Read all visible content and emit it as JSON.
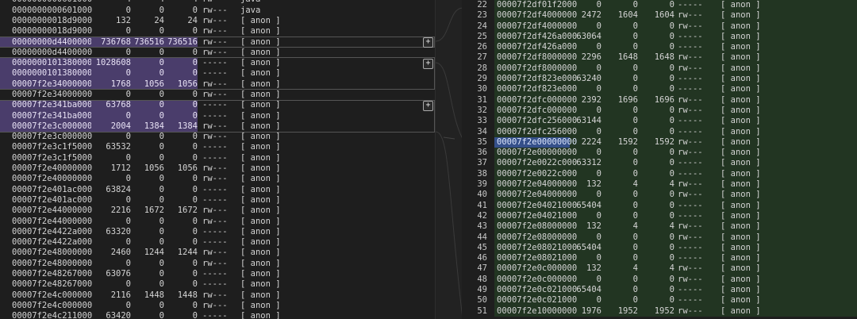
{
  "left": {
    "rows": [
      {
        "addr": "0000000000601000",
        "n1": "4",
        "n2": "4",
        "n3": "4",
        "perm": "rw---",
        "map": "java"
      },
      {
        "addr": "0000000000601000",
        "n1": "0",
        "n2": "0",
        "n3": "0",
        "perm": "rw---",
        "map": "java"
      },
      {
        "addr": "00000000018d9000",
        "n1": "132",
        "n2": "24",
        "n3": "24",
        "perm": "rw---",
        "map": "[ anon ]"
      },
      {
        "addr": "00000000018d9000",
        "n1": "0",
        "n2": "0",
        "n3": "0",
        "perm": "rw---",
        "map": "[ anon ]"
      },
      {
        "addr": "00000000d4400000",
        "n1": "736768",
        "n2": "736516",
        "n3": "736516",
        "perm": "rw---",
        "map": "[ anon ]",
        "hl": true
      },
      {
        "addr": "00000000d4400000",
        "n1": "0",
        "n2": "0",
        "n3": "0",
        "perm": "rw---",
        "map": "[ anon ]"
      },
      {
        "addr": "0000000101380000",
        "n1": "1028608",
        "n2": "0",
        "n3": "0",
        "perm": "-----",
        "map": "[ anon ]",
        "hl": true
      },
      {
        "addr": "0000000101380000",
        "n1": "0",
        "n2": "0",
        "n3": "0",
        "perm": "-----",
        "map": "[ anon ]",
        "hl": true
      },
      {
        "addr": "00007f2e34000000",
        "n1": "1768",
        "n2": "1056",
        "n3": "1056",
        "perm": "rw---",
        "map": "[ anon ]",
        "hl": true
      },
      {
        "addr": "00007f2e34000000",
        "n1": "0",
        "n2": "0",
        "n3": "0",
        "perm": "rw---",
        "map": "[ anon ]"
      },
      {
        "addr": "00007f2e341ba000",
        "n1": "63768",
        "n2": "0",
        "n3": "0",
        "perm": "-----",
        "map": "[ anon ]",
        "hl": true
      },
      {
        "addr": "00007f2e341ba000",
        "n1": "0",
        "n2": "0",
        "n3": "0",
        "perm": "-----",
        "map": "[ anon ]",
        "hl": true
      },
      {
        "addr": "00007f2e3c000000",
        "n1": "2004",
        "n2": "1384",
        "n3": "1384",
        "perm": "rw---",
        "map": "[ anon ]",
        "hl": true
      },
      {
        "addr": "00007f2e3c000000",
        "n1": "0",
        "n2": "0",
        "n3": "0",
        "perm": "rw---",
        "map": "[ anon ]"
      },
      {
        "addr": "00007f2e3c1f5000",
        "n1": "63532",
        "n2": "0",
        "n3": "0",
        "perm": "-----",
        "map": "[ anon ]"
      },
      {
        "addr": "00007f2e3c1f5000",
        "n1": "0",
        "n2": "0",
        "n3": "0",
        "perm": "-----",
        "map": "[ anon ]"
      },
      {
        "addr": "00007f2e40000000",
        "n1": "1712",
        "n2": "1056",
        "n3": "1056",
        "perm": "rw---",
        "map": "[ anon ]"
      },
      {
        "addr": "00007f2e40000000",
        "n1": "0",
        "n2": "0",
        "n3": "0",
        "perm": "rw---",
        "map": "[ anon ]"
      },
      {
        "addr": "00007f2e401ac000",
        "n1": "63824",
        "n2": "0",
        "n3": "0",
        "perm": "-----",
        "map": "[ anon ]"
      },
      {
        "addr": "00007f2e401ac000",
        "n1": "0",
        "n2": "0",
        "n3": "0",
        "perm": "-----",
        "map": "[ anon ]"
      },
      {
        "addr": "00007f2e44000000",
        "n1": "2216",
        "n2": "1672",
        "n3": "1672",
        "perm": "rw---",
        "map": "[ anon ]"
      },
      {
        "addr": "00007f2e44000000",
        "n1": "0",
        "n2": "0",
        "n3": "0",
        "perm": "rw---",
        "map": "[ anon ]"
      },
      {
        "addr": "00007f2e4422a000",
        "n1": "63320",
        "n2": "0",
        "n3": "0",
        "perm": "-----",
        "map": "[ anon ]"
      },
      {
        "addr": "00007f2e4422a000",
        "n1": "0",
        "n2": "0",
        "n3": "0",
        "perm": "-----",
        "map": "[ anon ]"
      },
      {
        "addr": "00007f2e48000000",
        "n1": "2460",
        "n2": "1244",
        "n3": "1244",
        "perm": "rw---",
        "map": "[ anon ]"
      },
      {
        "addr": "00007f2e48000000",
        "n1": "0",
        "n2": "0",
        "n3": "0",
        "perm": "rw---",
        "map": "[ anon ]"
      },
      {
        "addr": "00007f2e48267000",
        "n1": "63076",
        "n2": "0",
        "n3": "0",
        "perm": "-----",
        "map": "[ anon ]"
      },
      {
        "addr": "00007f2e48267000",
        "n1": "0",
        "n2": "0",
        "n3": "0",
        "perm": "-----",
        "map": "[ anon ]"
      },
      {
        "addr": "00007f2e4c000000",
        "n1": "2116",
        "n2": "1448",
        "n3": "1448",
        "perm": "rw---",
        "map": "[ anon ]"
      },
      {
        "addr": "00007f2e4c000000",
        "n1": "0",
        "n2": "0",
        "n3": "0",
        "perm": "rw---",
        "map": "[ anon ]"
      },
      {
        "addr": "00007f2e4c211000",
        "n1": "63420",
        "n2": "0",
        "n3": "0",
        "perm": "-----",
        "map": "[ anon ]"
      }
    ]
  },
  "right": {
    "rows": [
      {
        "num": "22",
        "addr": "00007f2df01f2000",
        "n1": "0",
        "n2": "0",
        "n3": "0",
        "perm": "-----",
        "map": "[ anon ]"
      },
      {
        "num": "23",
        "addr": "00007f2df4000000",
        "n1": "2472",
        "n2": "1604",
        "n3": "1604",
        "perm": "rw---",
        "map": "[ anon ]"
      },
      {
        "num": "24",
        "addr": "00007f2df4000000",
        "n1": "0",
        "n2": "0",
        "n3": "0",
        "perm": "rw---",
        "map": "[ anon ]"
      },
      {
        "num": "25",
        "addr": "00007f2df426a000",
        "n1": "63064",
        "n2": "0",
        "n3": "0",
        "perm": "-----",
        "map": "[ anon ]"
      },
      {
        "num": "26",
        "addr": "00007f2df426a000",
        "n1": "0",
        "n2": "0",
        "n3": "0",
        "perm": "-----",
        "map": "[ anon ]"
      },
      {
        "num": "27",
        "addr": "00007f2df8000000",
        "n1": "2296",
        "n2": "1648",
        "n3": "1648",
        "perm": "rw---",
        "map": "[ anon ]"
      },
      {
        "num": "28",
        "addr": "00007f2df8000000",
        "n1": "0",
        "n2": "0",
        "n3": "0",
        "perm": "rw---",
        "map": "[ anon ]"
      },
      {
        "num": "29",
        "addr": "00007f2df823e000",
        "n1": "63240",
        "n2": "0",
        "n3": "0",
        "perm": "-----",
        "map": "[ anon ]"
      },
      {
        "num": "30",
        "addr": "00007f2df823e000",
        "n1": "0",
        "n2": "0",
        "n3": "0",
        "perm": "-----",
        "map": "[ anon ]"
      },
      {
        "num": "31",
        "addr": "00007f2dfc000000",
        "n1": "2392",
        "n2": "1696",
        "n3": "1696",
        "perm": "rw---",
        "map": "[ anon ]"
      },
      {
        "num": "32",
        "addr": "00007f2dfc000000",
        "n1": "0",
        "n2": "0",
        "n3": "0",
        "perm": "rw---",
        "map": "[ anon ]"
      },
      {
        "num": "33",
        "addr": "00007f2dfc256000",
        "n1": "63144",
        "n2": "0",
        "n3": "0",
        "perm": "-----",
        "map": "[ anon ]"
      },
      {
        "num": "34",
        "addr": "00007f2dfc256000",
        "n1": "0",
        "n2": "0",
        "n3": "0",
        "perm": "-----",
        "map": "[ anon ]"
      },
      {
        "num": "35",
        "addr": "00007f2e00000000",
        "n1": "2224",
        "n2": "1592",
        "n3": "1592",
        "perm": "rw---",
        "map": "[ anon ]",
        "sel": true
      },
      {
        "num": "36",
        "addr": "00007f2e00000000",
        "n1": "0",
        "n2": "0",
        "n3": "0",
        "perm": "rw---",
        "map": "[ anon ]"
      },
      {
        "num": "37",
        "addr": "00007f2e0022c000",
        "n1": "63312",
        "n2": "0",
        "n3": "0",
        "perm": "-----",
        "map": "[ anon ]"
      },
      {
        "num": "38",
        "addr": "00007f2e0022c000",
        "n1": "0",
        "n2": "0",
        "n3": "0",
        "perm": "-----",
        "map": "[ anon ]"
      },
      {
        "num": "39",
        "addr": "00007f2e04000000",
        "n1": "132",
        "n2": "4",
        "n3": "4",
        "perm": "rw---",
        "map": "[ anon ]"
      },
      {
        "num": "40",
        "addr": "00007f2e04000000",
        "n1": "0",
        "n2": "0",
        "n3": "0",
        "perm": "rw---",
        "map": "[ anon ]"
      },
      {
        "num": "41",
        "addr": "00007f2e04021000",
        "n1": "65404",
        "n2": "0",
        "n3": "0",
        "perm": "-----",
        "map": "[ anon ]"
      },
      {
        "num": "42",
        "addr": "00007f2e04021000",
        "n1": "0",
        "n2": "0",
        "n3": "0",
        "perm": "-----",
        "map": "[ anon ]"
      },
      {
        "num": "43",
        "addr": "00007f2e08000000",
        "n1": "132",
        "n2": "4",
        "n3": "4",
        "perm": "rw---",
        "map": "[ anon ]"
      },
      {
        "num": "44",
        "addr": "00007f2e08000000",
        "n1": "0",
        "n2": "0",
        "n3": "0",
        "perm": "rw---",
        "map": "[ anon ]"
      },
      {
        "num": "45",
        "addr": "00007f2e08021000",
        "n1": "65404",
        "n2": "0",
        "n3": "0",
        "perm": "-----",
        "map": "[ anon ]"
      },
      {
        "num": "46",
        "addr": "00007f2e08021000",
        "n1": "0",
        "n2": "0",
        "n3": "0",
        "perm": "-----",
        "map": "[ anon ]"
      },
      {
        "num": "47",
        "addr": "00007f2e0c000000",
        "n1": "132",
        "n2": "4",
        "n3": "4",
        "perm": "rw---",
        "map": "[ anon ]"
      },
      {
        "num": "48",
        "addr": "00007f2e0c000000",
        "n1": "0",
        "n2": "0",
        "n3": "0",
        "perm": "rw---",
        "map": "[ anon ]"
      },
      {
        "num": "49",
        "addr": "00007f2e0c021000",
        "n1": "65404",
        "n2": "0",
        "n3": "0",
        "perm": "-----",
        "map": "[ anon ]"
      },
      {
        "num": "50",
        "addr": "00007f2e0c021000",
        "n1": "0",
        "n2": "0",
        "n3": "0",
        "perm": "-----",
        "map": "[ anon ]"
      },
      {
        "num": "51",
        "addr": "00007f2e10000000",
        "n1": "1976",
        "n2": "1952",
        "n3": "1952",
        "perm": "rw---",
        "map": "[ anon ]"
      }
    ]
  },
  "expand_label": "+",
  "colors": {
    "background": "#1e1e1e",
    "added_row": "#223522",
    "highlight": "#4a3d6b",
    "selection": "#35508a"
  }
}
